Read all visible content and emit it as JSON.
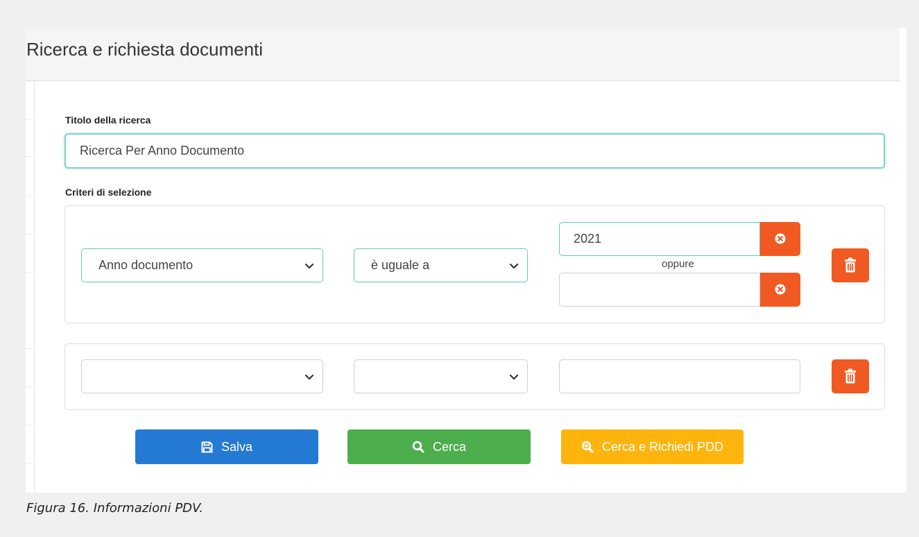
{
  "panel": {
    "title": "Ricerca e richiesta documenti"
  },
  "form": {
    "title_label": "Titolo della ricerca",
    "title_value": "Ricerca Per Anno Documento",
    "criteria_label": "Criteri di selezione"
  },
  "criteria": [
    {
      "field": "Anno documento",
      "operator": "è uguale a",
      "values": [
        "2021",
        ""
      ],
      "separator": "oppure"
    },
    {
      "field": "",
      "operator": "",
      "values": [
        ""
      ]
    }
  ],
  "actions": {
    "save_label": "Salva",
    "search_label": "Cerca",
    "search_request_label": "Cerca e Richiedi PDD"
  },
  "caption": "Figura 16. Informazioni PDV.",
  "icons": {
    "chevron": "chevron-down-icon",
    "clear": "times-circle-icon",
    "trash": "trash-icon",
    "save": "floppy-disk-icon",
    "search": "search-icon",
    "search_plus": "search-plus-icon"
  },
  "colors": {
    "primary": "#2479d3",
    "success": "#4cae4c",
    "warning": "#fdb40c",
    "danger": "#f05a22",
    "focus_border": "#5ccab8"
  }
}
